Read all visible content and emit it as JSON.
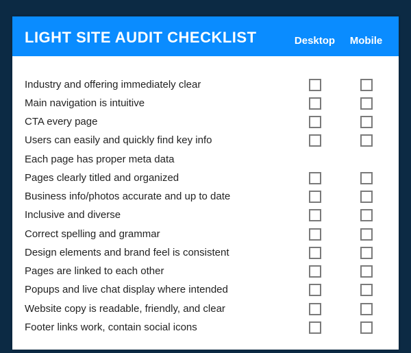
{
  "header": {
    "title": "LIGHT SITE AUDIT CHECKLIST",
    "col_desktop": "Desktop",
    "col_mobile": "Mobile"
  },
  "rows": [
    {
      "label": "",
      "desktop": false,
      "mobile": false,
      "spacer": true
    },
    {
      "label": "Industry and offering immediately clear",
      "desktop": true,
      "mobile": true
    },
    {
      "label": "Main navigation is intuitive",
      "desktop": true,
      "mobile": true
    },
    {
      "label": "CTA every page",
      "desktop": true,
      "mobile": true
    },
    {
      "label": "Users can easily and quickly find key info",
      "desktop": true,
      "mobile": true
    },
    {
      "label": "Each page has proper meta data",
      "desktop": false,
      "mobile": false
    },
    {
      "label": "Pages clearly titled and organized",
      "desktop": true,
      "mobile": true
    },
    {
      "label": "Business info/photos accurate and up to date",
      "desktop": true,
      "mobile": true
    },
    {
      "label": "Inclusive and diverse",
      "desktop": true,
      "mobile": true
    },
    {
      "label": "Correct spelling and grammar",
      "desktop": true,
      "mobile": true
    },
    {
      "label": "Design elements and brand feel is consistent",
      "desktop": true,
      "mobile": true
    },
    {
      "label": "Pages are linked to each other",
      "desktop": true,
      "mobile": true
    },
    {
      "label": "Popups and live chat display where intended",
      "desktop": true,
      "mobile": true
    },
    {
      "label": "Website copy is readable, friendly, and clear",
      "desktop": true,
      "mobile": true
    },
    {
      "label": "Footer links work, contain social icons",
      "desktop": true,
      "mobile": true
    }
  ]
}
